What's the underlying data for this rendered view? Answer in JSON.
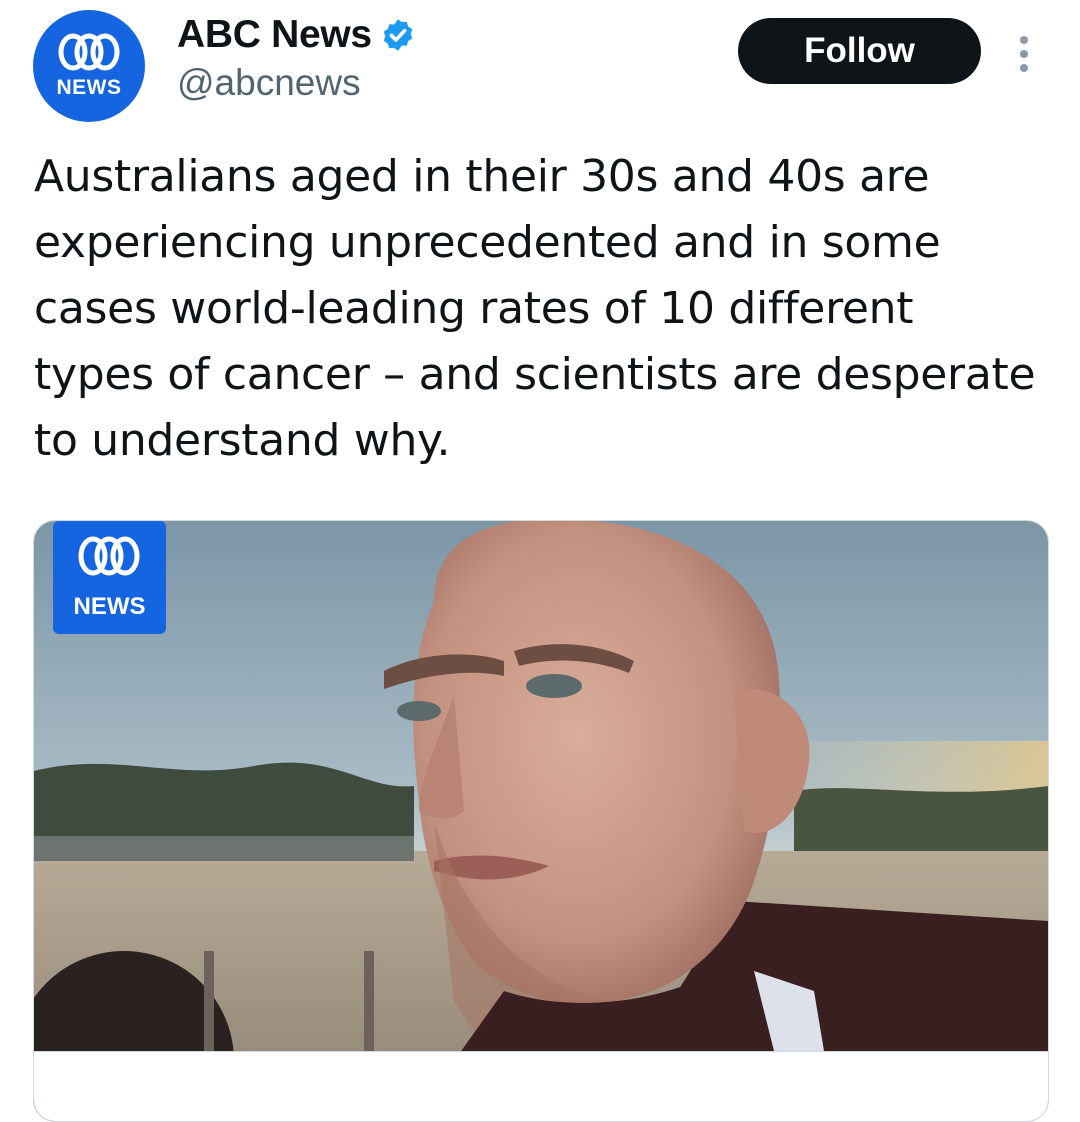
{
  "account": {
    "display_name": "ABC News",
    "handle": "@abcnews",
    "verified": true,
    "avatar_text": "NEWS",
    "avatar_icon": "abc-lissajous-logo"
  },
  "actions": {
    "follow_label": "Follow",
    "more_icon": "more-vertical-icon"
  },
  "tweet": {
    "text": "Australians aged in their 30s and 40s are experiencing unprecedented and in some cases world-leading rates of 10 different types of cancer – and scientists are desperate to understand why."
  },
  "media": {
    "logo_text": "NEWS",
    "subject": "photo-man-at-beach"
  },
  "colors": {
    "brand_blue": "#1565e0",
    "verified_blue": "#1d9bf0",
    "follow_bg": "#0f1419",
    "muted": "#536471"
  }
}
